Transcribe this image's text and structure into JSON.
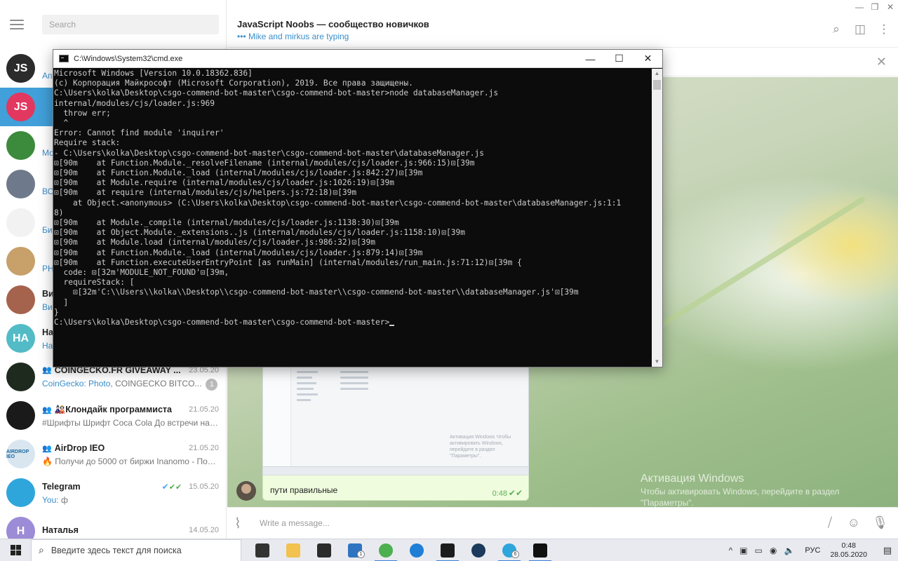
{
  "window_controls": {
    "minimize": "—",
    "maximize": "❐",
    "close": "✕"
  },
  "telegram": {
    "search": {
      "placeholder": "Search"
    },
    "chats": [
      {
        "name": "",
        "preview": "Ап",
        "date": "",
        "avatar_color": "#2b2b2b",
        "avatar_text": "JS"
      },
      {
        "name": "",
        "preview": "",
        "date": "",
        "avatar_color": "#e2375f",
        "avatar_text": "JS",
        "active": true
      },
      {
        "name": "",
        "preview": "Мо",
        "date": "",
        "avatar_color": "#3c8a3c",
        "avatar_text": ""
      },
      {
        "name": "",
        "preview": "ВС",
        "date": "",
        "avatar_color": "#6e7a8c",
        "avatar_text": ""
      },
      {
        "name": "",
        "preview": "Би",
        "date": "",
        "avatar_color": "#f2f2f2",
        "avatar_text": ""
      },
      {
        "name": "",
        "preview": "PH",
        "date": "",
        "avatar_color": "#c7a06a",
        "avatar_text": ""
      },
      {
        "name": "Ви",
        "preview": "Ви",
        "date": "",
        "avatar_color": "#a5624c",
        "avatar_text": ""
      },
      {
        "name": "На",
        "preview": "На",
        "date": "",
        "avatar_color": "#52bbc6",
        "avatar_text": "HA"
      },
      {
        "name": "COINGECKO.FR GIVEAWAY ...",
        "preview_hl": "CoinGecko: Photo,",
        "preview": "COINGECKO BITCO...",
        "date": "23.05.20",
        "badge": "1",
        "avatar_color": "#1e2a1e",
        "avatar_text": ""
      },
      {
        "name": "🎎Клондайк программиста",
        "preview": "#Шрифты Шрифт Coca Cola  До встречи на т...",
        "date": "21.05.20",
        "avatar_color": "#1a1a1a",
        "avatar_text": ""
      },
      {
        "name": "AirDrop IEO",
        "preview": "🔥 Получи до 5000 от биржи Inanomo - Под...",
        "date": "21.05.20",
        "avatar_color": "#d9e6ef",
        "avatar_text": "AIRDROP IEO"
      },
      {
        "name": "Telegram",
        "preview_hl": "You:",
        "preview": "ф",
        "date": "15.05.20",
        "verified": "✔",
        "ticks": "✔✔",
        "avatar_color": "#2ea6db",
        "avatar_text": ""
      },
      {
        "name": "Наталья",
        "preview": "",
        "date": "14.05.20",
        "avatar_color": "#9c8bd6",
        "avatar_text": "H"
      }
    ],
    "header": {
      "title": "JavaScript Noobs — сообщество новичков",
      "typing": "••• Mike and mirkus are typing"
    },
    "message": {
      "text": "пути правильные",
      "time": "0:48",
      "check": "✔✔",
      "photo_activation": "Активация Windows\nЧтобы активировать Windows, перейдите в раздел \"Параметры\"."
    },
    "activation": {
      "line1": "Активация Windows",
      "line2": "Чтобы активировать Windows, перейдите в раздел",
      "line3": "\"Параметры\"."
    },
    "compose": {
      "placeholder": "Write a message..."
    }
  },
  "cmd": {
    "title": "C:\\Windows\\System32\\cmd.exe",
    "buttons": {
      "minimize": "—",
      "maximize": "☐",
      "close": "✕"
    },
    "lines": [
      "Microsoft Windows [Version 10.0.18362.836]",
      "(c) Корпорация Майкрософт (Microsoft Corporation), 2019. Все права защищены.",
      "",
      "C:\\Users\\kolka\\Desktop\\csgo-commend-bot-master\\csgo-commend-bot-master>node databaseManager.js",
      "internal/modules/cjs/loader.js:969",
      "  throw err;",
      "  ^",
      "",
      "Error: Cannot find module 'inquirer'",
      "Require stack:",
      "- C:\\Users\\kolka\\Desktop\\csgo-commend-bot-master\\csgo-commend-bot-master\\databaseManager.js",
      "⊡[90m    at Function.Module._resolveFilename (internal/modules/cjs/loader.js:966:15)⊡[39m",
      "⊡[90m    at Function.Module._load (internal/modules/cjs/loader.js:842:27)⊡[39m",
      "⊡[90m    at Module.require (internal/modules/cjs/loader.js:1026:19)⊡[39m",
      "⊡[90m    at require (internal/modules/cjs/helpers.js:72:18)⊡[39m",
      "    at Object.<anonymous> (C:\\Users\\kolka\\Desktop\\csgo-commend-bot-master\\csgo-commend-bot-master\\databaseManager.js:1:1",
      "8)",
      "⊡[90m    at Module._compile (internal/modules/cjs/loader.js:1138:30)⊡[39m",
      "⊡[90m    at Object.Module._extensions..js (internal/modules/cjs/loader.js:1158:10)⊡[39m",
      "⊡[90m    at Module.load (internal/modules/cjs/loader.js:986:32)⊡[39m",
      "⊡[90m    at Function.Module._load (internal/modules/cjs/loader.js:879:14)⊡[39m",
      "⊡[90m    at Function.executeUserEntryPoint [as runMain] (internal/modules/run_main.js:71:12)⊡[39m {",
      "  code: ⊡[32m'MODULE_NOT_FOUND'⊡[39m,",
      "  requireStack: [",
      "    ⊡[32m'C:\\\\Users\\\\kolka\\\\Desktop\\\\csgo-commend-bot-master\\\\csgo-commend-bot-master\\\\databaseManager.js'⊡[39m",
      "  ]",
      "}",
      "",
      "C:\\Users\\kolka\\Desktop\\csgo-commend-bot-master\\csgo-commend-bot-master>"
    ]
  },
  "taskbar": {
    "search_placeholder": "Введите здесь текст для поиска",
    "apps": [
      {
        "name": "task-view",
        "color": "#333333",
        "running": false
      },
      {
        "name": "file-explorer",
        "color": "#f2c14e",
        "running": false
      },
      {
        "name": "store",
        "color": "#2b2b2b",
        "running": false
      },
      {
        "name": "mail",
        "color": "#2f74c0",
        "running": false,
        "badge": "1"
      },
      {
        "name": "chrome",
        "color": "#4caf50",
        "running": true
      },
      {
        "name": "edge",
        "color": "#1f7ed6",
        "running": false
      },
      {
        "name": "terminal",
        "color": "#1c1c1c",
        "running": true
      },
      {
        "name": "steam",
        "color": "#1b3a5c",
        "running": false
      },
      {
        "name": "telegram",
        "color": "#2ea6db",
        "running": true,
        "badge": "6"
      },
      {
        "name": "cmd",
        "color": "#111111",
        "running": true
      }
    ],
    "tray": {
      "chevron": "^",
      "lang": "РУС",
      "time": "0:48",
      "date": "28.05.2020"
    }
  }
}
